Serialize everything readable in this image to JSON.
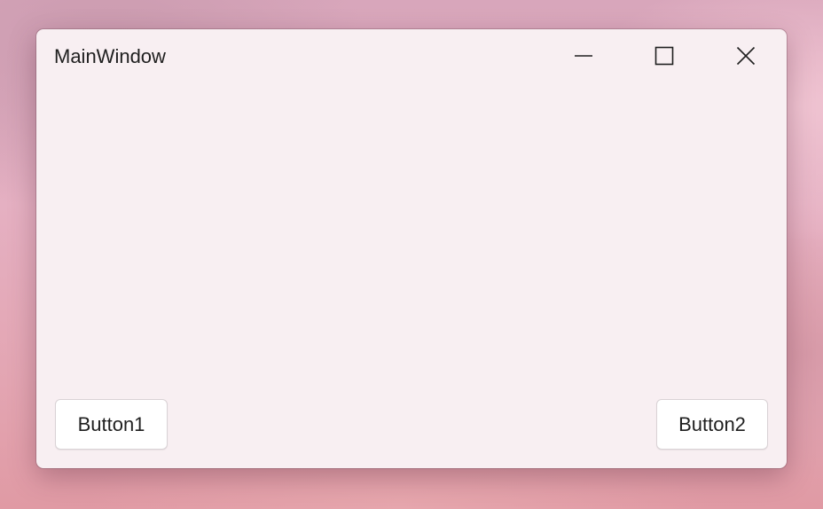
{
  "window": {
    "title": "MainWindow"
  },
  "caption_buttons": {
    "minimize_icon": "minimize-icon",
    "maximize_icon": "maximize-icon",
    "close_icon": "close-icon"
  },
  "buttons": [
    {
      "label": "Button1"
    },
    {
      "label": "Button2"
    }
  ],
  "colors": {
    "window_background": "#f8eff2",
    "button_background": "#ffffff",
    "text": "#1f1f1f"
  }
}
